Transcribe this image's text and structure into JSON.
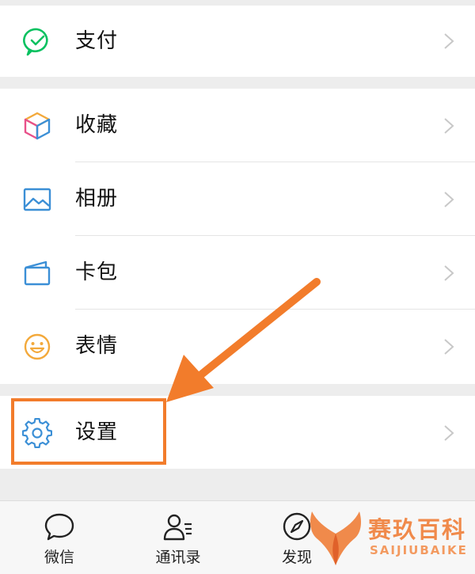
{
  "menu": {
    "pay_label": "支付",
    "favorites_label": "收藏",
    "album_label": "相册",
    "cards_label": "卡包",
    "stickers_label": "表情",
    "settings_label": "设置"
  },
  "tabbar": {
    "chats_label": "微信",
    "contacts_label": "通讯录",
    "discover_label": "发现"
  },
  "watermark": {
    "brand_cn": "赛玖百科",
    "brand_en": "SAIJIUBAIKE"
  },
  "colors": {
    "pay_green": "#07c160",
    "accent_blue": "#3b8fd6",
    "highlight_orange": "#f27c2b"
  }
}
